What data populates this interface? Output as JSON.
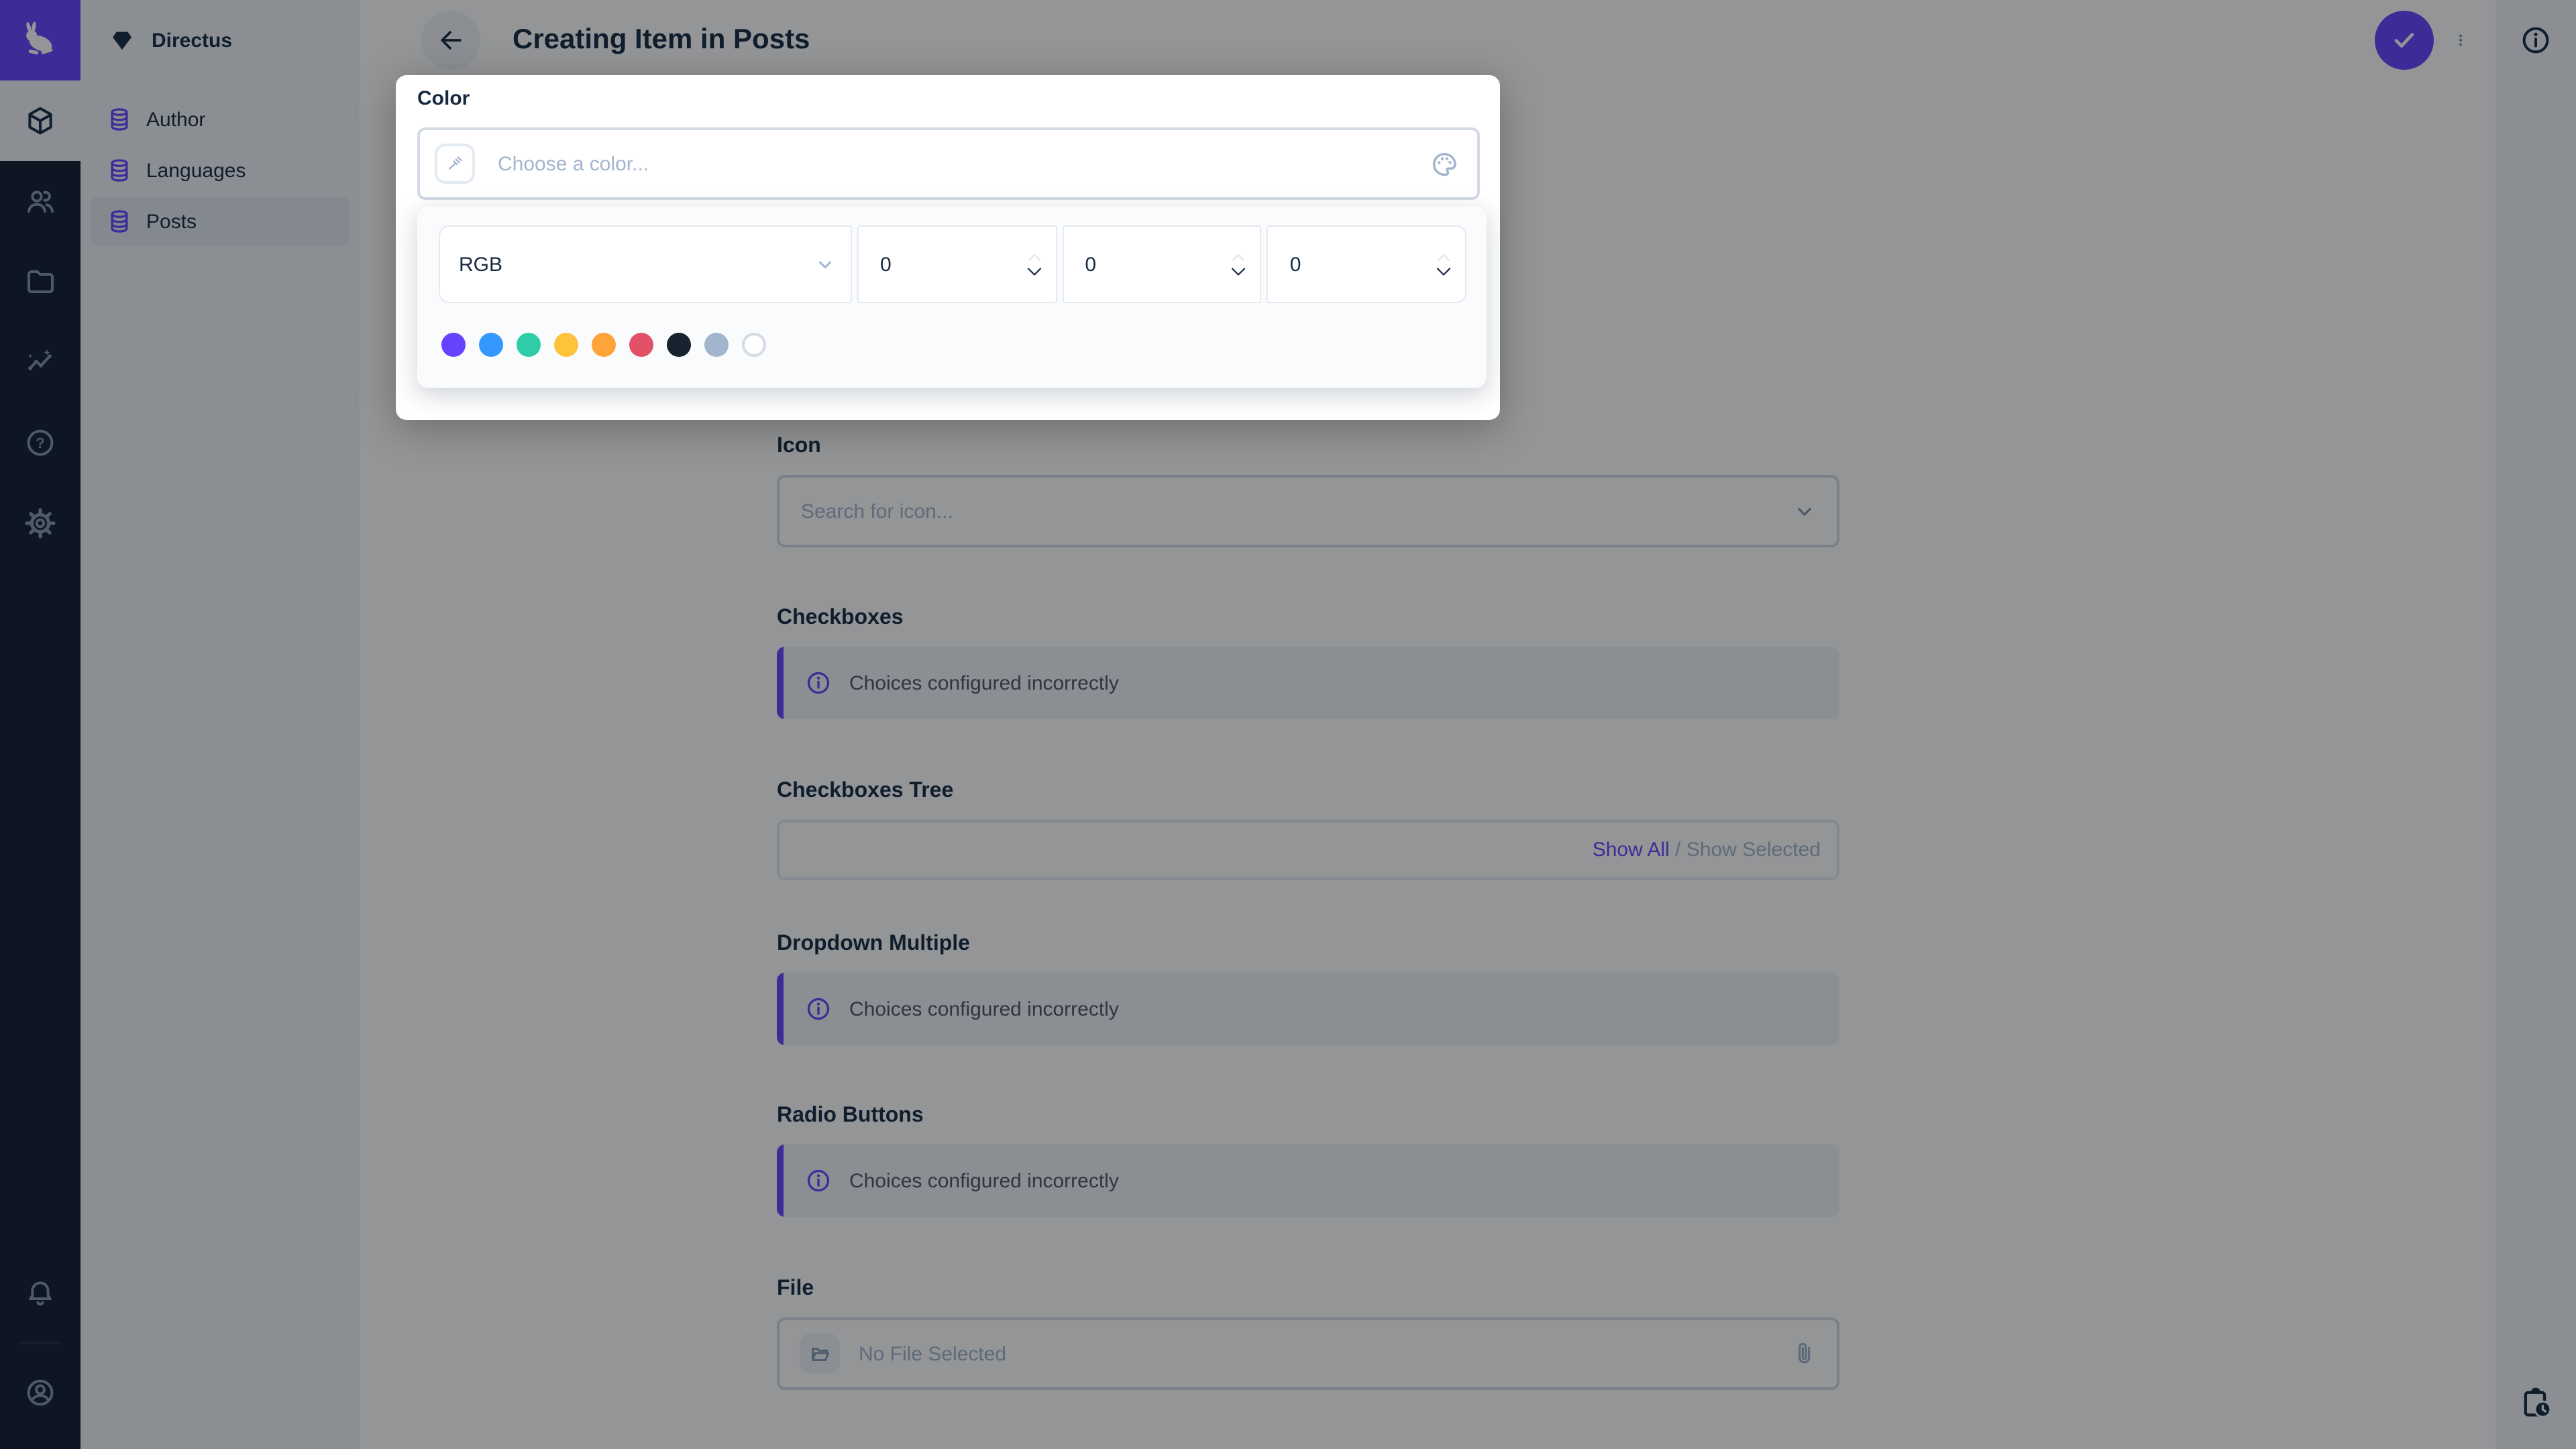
{
  "colors": {
    "accent": "#6644FF",
    "module_bar_bg": "#121D30",
    "nav_bg": "#F0F4F9",
    "border": "#D3DAE4",
    "border_subtle": "#E4EAF1",
    "placeholder": "#A2B5CD",
    "text": "#172940",
    "text_subdued": "#4F5464"
  },
  "module_bar": {
    "logo_icon": "directus-rabbit-logo",
    "modules": [
      {
        "name": "content",
        "icon": "box-icon",
        "active": true
      },
      {
        "name": "user-directory",
        "icon": "people-icon"
      },
      {
        "name": "file-library",
        "icon": "folder-icon"
      },
      {
        "name": "insights",
        "icon": "insights-icon"
      },
      {
        "name": "documentation",
        "icon": "help-icon"
      },
      {
        "name": "settings",
        "icon": "gear-icon"
      }
    ],
    "bottom": [
      {
        "name": "notifications",
        "icon": "bell-icon"
      },
      {
        "name": "account",
        "icon": "account-circle-icon"
      }
    ]
  },
  "nav": {
    "project_name": "Directus",
    "project_icon": "gem-icon",
    "items": [
      {
        "label": "Author",
        "icon": "database-icon"
      },
      {
        "label": "Languages",
        "icon": "database-icon"
      },
      {
        "label": "Posts",
        "icon": "database-icon",
        "active": true
      }
    ]
  },
  "header": {
    "title": "Creating Item in Posts",
    "back_icon": "arrow-left-icon",
    "actions": [
      {
        "name": "save",
        "icon": "check-icon"
      },
      {
        "name": "more-options",
        "icon": "kebab-menu-icon"
      }
    ]
  },
  "right_sidebar": {
    "top_icon": "info-icon",
    "bottom_icon": "clipboard-clock-icon"
  },
  "color_picker": {
    "label": "Color",
    "placeholder": "Choose a color...",
    "left_icon": "eyedropper-icon",
    "right_icon": "palette-icon",
    "mode": "RGB",
    "channels": [
      {
        "value": "0"
      },
      {
        "value": "0"
      },
      {
        "value": "0"
      }
    ],
    "presets": [
      "#6644FF",
      "#3399FF",
      "#2ECDA7",
      "#FFC23B",
      "#FFA439",
      "#E35169",
      "#18222F",
      "#A2B5CD",
      "#FFFFFF"
    ]
  },
  "form": {
    "fields": [
      {
        "label": "Icon",
        "type": "icon-search",
        "placeholder": "Search for icon..."
      },
      {
        "label": "Checkboxes",
        "type": "notice",
        "text": "Choices configured incorrectly"
      },
      {
        "label": "Checkboxes Tree",
        "type": "tree",
        "show_all": "Show All",
        "separator": " / ",
        "show_selected": "Show Selected"
      },
      {
        "label": "Dropdown Multiple",
        "type": "notice",
        "text": "Choices configured incorrectly"
      },
      {
        "label": "Radio Buttons",
        "type": "notice",
        "text": "Choices configured incorrectly"
      },
      {
        "label": "File",
        "type": "file",
        "placeholder": "No File Selected"
      }
    ]
  }
}
